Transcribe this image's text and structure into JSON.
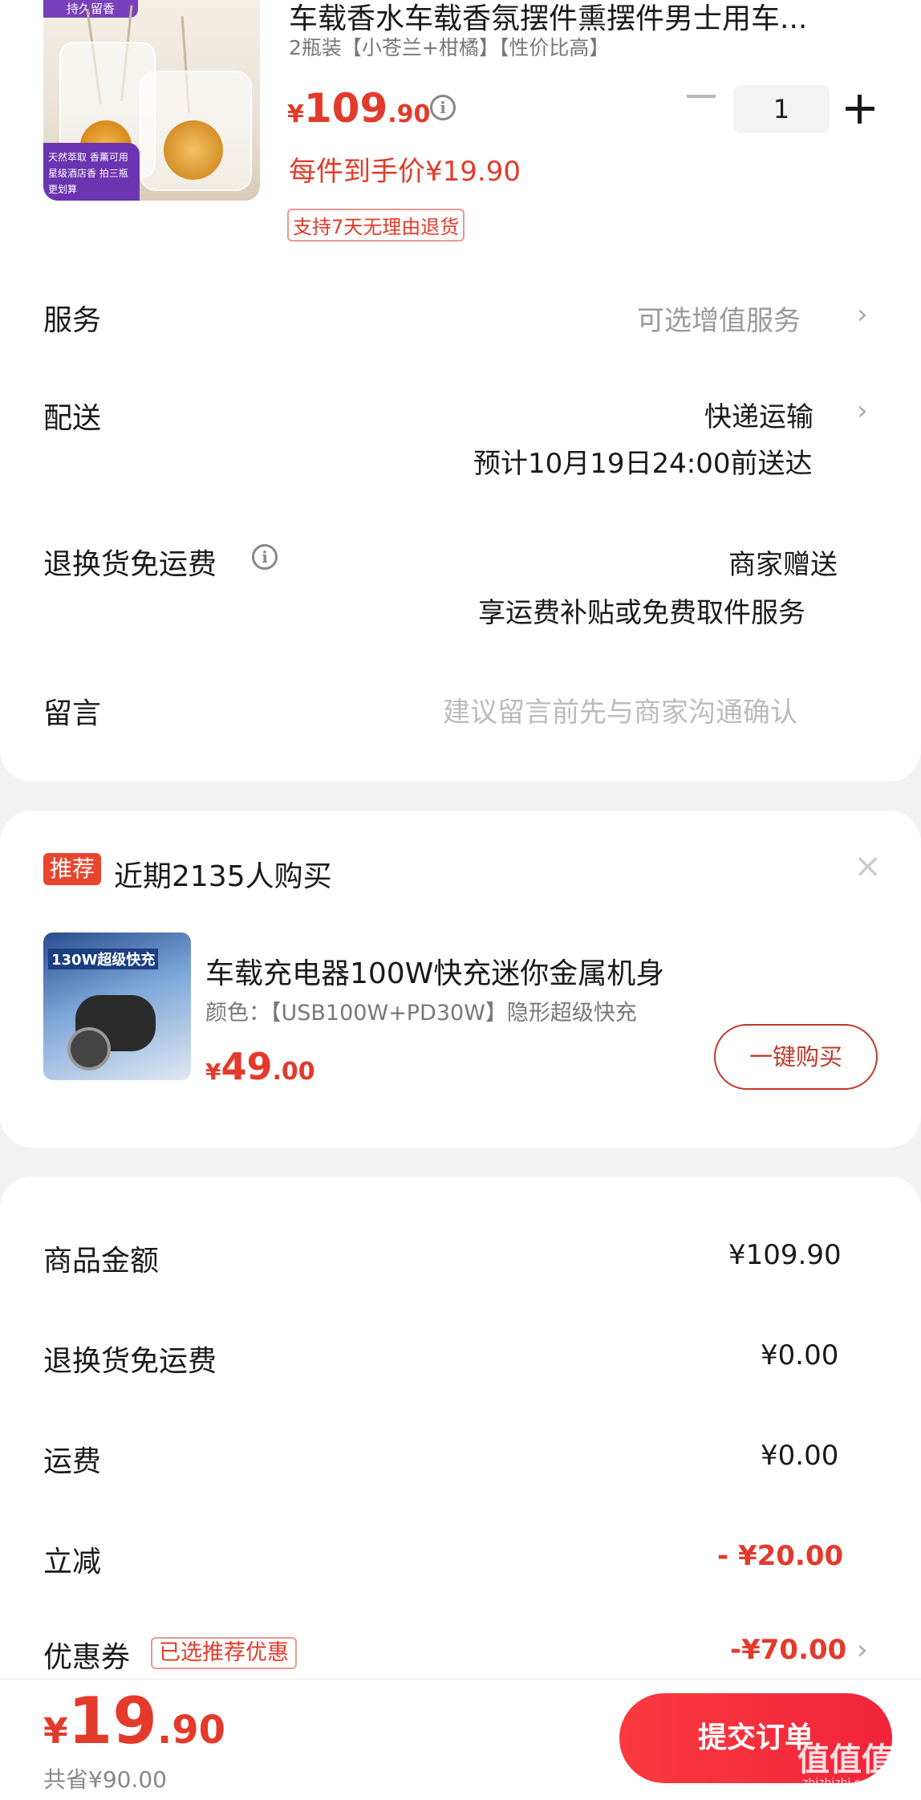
{
  "product": {
    "thumb_tag": "持久留香",
    "thumb_badge": "天然萃取 香薰可用 星级酒店香 拍三瓶更划算",
    "title": "车载香水车载香氛摆件熏摆件男士用车...",
    "subtitle": "2瓶装【小苍兰+柑橘】【性价比高】",
    "price_symbol": "¥",
    "price_int": "109",
    "price_dec": ".90",
    "per_price": "每件到手价¥19.90",
    "return_tag": "支持7天无理由退货",
    "quantity": "1"
  },
  "rows": {
    "service_label": "服务",
    "service_value": "可选增值服务",
    "delivery_label": "配送",
    "delivery_value": "快递运输",
    "delivery_eta": "预计10月19日24:00前送达",
    "return_free_label": "退换货免运费",
    "return_free_value": "商家赠送",
    "return_free_desc": "享运费补贴或免费取件服务",
    "message_label": "留言",
    "message_placeholder": "建议留言前先与商家沟通确认"
  },
  "recommend": {
    "badge": "推荐",
    "title": "近期2135人购买",
    "close": "×",
    "thumb_text": "130W超级快充",
    "name": "车载充电器100W快充迷你金属机身",
    "spec": "颜色：【USB100W+PD30W】隐形超级快充",
    "price_symbol": "¥",
    "price_int": "49",
    "price_dec": ".00",
    "buy_label": "一键购买"
  },
  "summary": {
    "goods_label": "商品金额",
    "goods_value": "¥109.90",
    "return_free_label": "退换货免运费",
    "return_free_value": "¥0.00",
    "shipping_label": "运费",
    "shipping_value": "¥0.00",
    "discount_label": "立减",
    "discount_value": "- ¥20.00",
    "coupon_label": "优惠券",
    "coupon_tag": "已选推荐优惠",
    "coupon_value": "-¥70.00"
  },
  "footer": {
    "price_symbol": "¥",
    "price_int": "19",
    "price_dec": ".90",
    "saved": "共省¥90.00",
    "submit_label": "提交订单",
    "watermark": "值值值",
    "watermark_sub": "zhizhizhi.com"
  },
  "colors": {
    "accent_red": "#e33a2b",
    "button_red": "#f0233a"
  }
}
